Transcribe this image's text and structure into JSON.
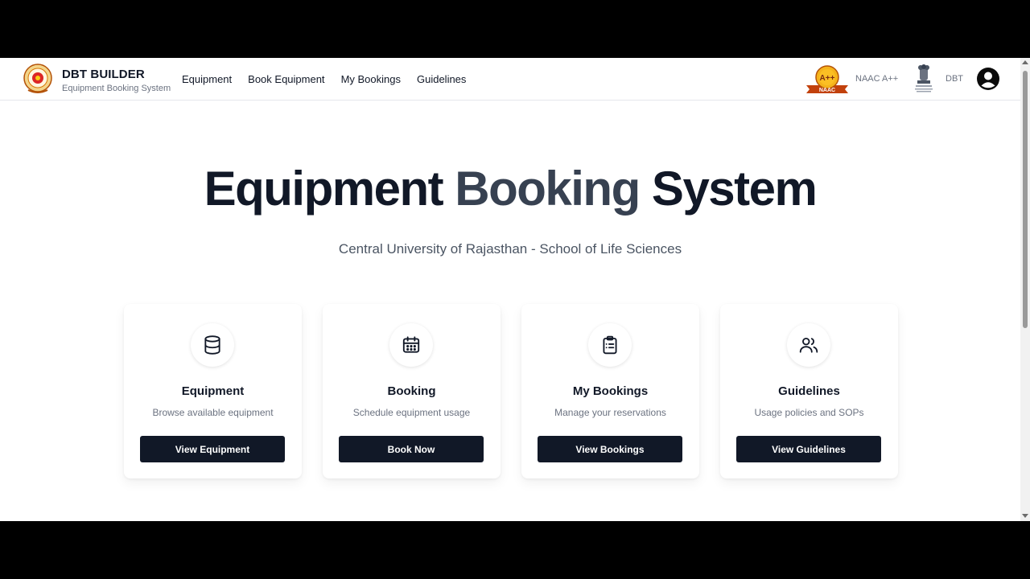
{
  "brand": {
    "name": "DBT BUILDER",
    "subtitle": "Equipment Booking System"
  },
  "nav": {
    "items": [
      {
        "label": "Equipment"
      },
      {
        "label": "Book Equipment"
      },
      {
        "label": "My Bookings"
      },
      {
        "label": "Guidelines"
      }
    ]
  },
  "header_right": {
    "naac_badge_text": "A++",
    "naac_badge_ribbon": "NAAC",
    "naac_label": "NAAC A++",
    "dbt_label": "DBT",
    "icons": [
      "naac-badge-icon",
      "national-emblem-icon",
      "user-account-icon"
    ]
  },
  "hero": {
    "title_part1": "Equipment",
    "title_part2": "Booking",
    "title_part3": "System",
    "subtitle": "Central University of Rajasthan - School of Life Sciences"
  },
  "cards": [
    {
      "icon": "database-icon",
      "title": "Equipment",
      "description": "Browse available equipment",
      "button": "View Equipment"
    },
    {
      "icon": "calendar-icon",
      "title": "Booking",
      "description": "Schedule equipment usage",
      "button": "Book Now"
    },
    {
      "icon": "clipboard-list-icon",
      "title": "My Bookings",
      "description": "Manage your reservations",
      "button": "View Bookings"
    },
    {
      "icon": "users-icon",
      "title": "Guidelines",
      "description": "Usage policies and SOPs",
      "button": "View Guidelines"
    }
  ],
  "colors": {
    "primary_dark": "#111827",
    "title_mid": "#374151",
    "muted_text": "#6b7280",
    "badge_gold": "#f5b31b",
    "badge_red": "#c2410c"
  }
}
